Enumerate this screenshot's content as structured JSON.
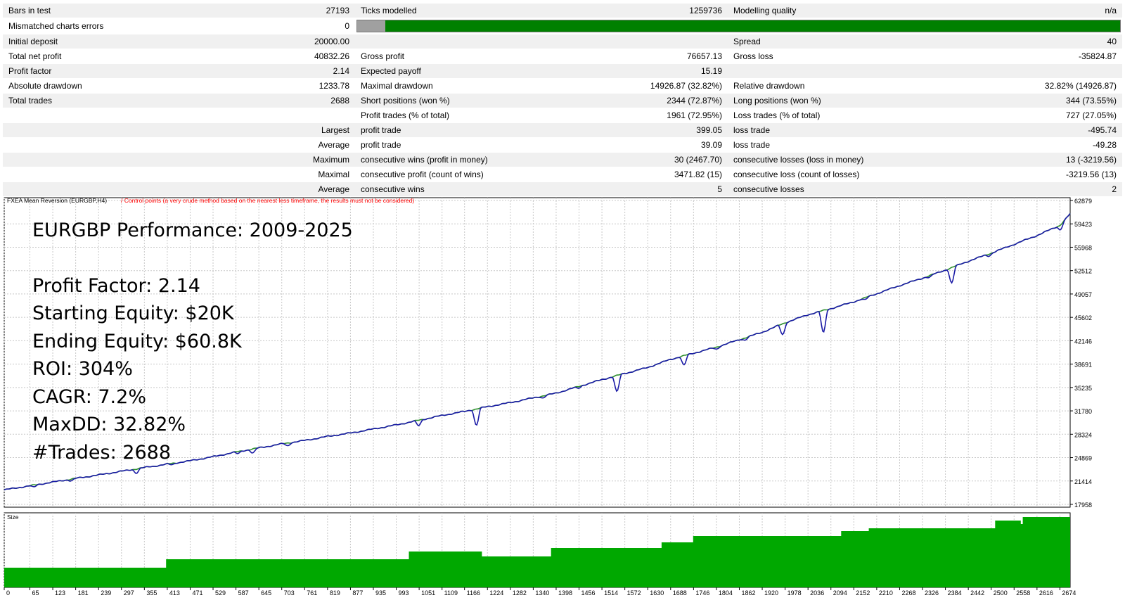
{
  "report": {
    "rows": [
      [
        "Bars in test",
        "27193",
        "Ticks modelled",
        "1259736",
        "Modelling quality",
        "n/a"
      ],
      [
        "Mismatched charts errors",
        "0",
        "__BAR__",
        "",
        "",
        ""
      ],
      [
        "Initial deposit",
        "20000.00",
        "",
        "",
        "Spread",
        "40"
      ],
      [
        "Total net profit",
        "40832.26",
        "Gross profit",
        "76657.13",
        "Gross loss",
        "-35824.87"
      ],
      [
        "Profit factor",
        "2.14",
        "Expected payoff",
        "15.19",
        "",
        ""
      ],
      [
        "Absolute drawdown",
        "1233.78",
        "Maximal drawdown",
        "14926.87 (32.82%)",
        "Relative drawdown",
        "32.82% (14926.87)"
      ],
      [
        "Total trades",
        "2688",
        "Short positions (won %)",
        "2344 (72.87%)",
        "Long positions (won %)",
        "344 (73.55%)"
      ],
      [
        "",
        "",
        "Profit trades (% of total)",
        "1961 (72.95%)",
        "Loss trades (% of total)",
        "727 (27.05%)"
      ],
      [
        "",
        "Largest",
        "profit trade",
        "399.05",
        "loss trade",
        "-495.74"
      ],
      [
        "",
        "Average",
        "profit trade",
        "39.09",
        "loss trade",
        "-49.28"
      ],
      [
        "",
        "Maximum",
        "consecutive wins (profit in money)",
        "30 (2467.70)",
        "consecutive losses (loss in money)",
        "13 (-3219.56)"
      ],
      [
        "",
        "Maximal",
        "consecutive profit (count of wins)",
        "3471.82 (15)",
        "consecutive loss (count of losses)",
        "-3219.56 (13)"
      ],
      [
        "",
        "Average",
        "consecutive wins",
        "5",
        "consecutive losses",
        "2"
      ]
    ],
    "quality_fraction": 0.037,
    "colors": {
      "bar_green": "#008000",
      "bar_grey": "#a0a0a0"
    }
  },
  "chart_data": {
    "type": "line",
    "header_title": "FXEA Mean Reversion (EURGBP,H4)",
    "header_note": "/ Control points (a very crude method based on the nearest less timeframe, the results must not be considered)",
    "overlay_lines": [
      "EURGBP Performance: 2009-2025",
      "Profit Factor: 2.14",
      "Starting Equity: $20K",
      "Ending Equity: $60.8K",
      "ROI: 304%",
      "CAGR: 7.2%",
      "MaxDD: 32.82%",
      "#Trades: 2688"
    ],
    "y_ticks": [
      "62879",
      "59423",
      "55968",
      "52512",
      "49057",
      "45602",
      "42146",
      "38691",
      "35235",
      "31780",
      "28324",
      "24869",
      "21414",
      "17958"
    ],
    "ylim": [
      17958,
      62879
    ],
    "x_ticks": [
      "0",
      "65",
      "123",
      "181",
      "239",
      "297",
      "355",
      "413",
      "471",
      "529",
      "587",
      "645",
      "703",
      "761",
      "819",
      "877",
      "935",
      "993",
      "1051",
      "1109",
      "1166",
      "1224",
      "1282",
      "1340",
      "1398",
      "1456",
      "1514",
      "1572",
      "1630",
      "1688",
      "1746",
      "1804",
      "1862",
      "1920",
      "1978",
      "2036",
      "2094",
      "2152",
      "2210",
      "2268",
      "2326",
      "2384",
      "2442",
      "2500",
      "2558",
      "2616",
      "2674"
    ],
    "xlim": [
      0,
      2700
    ],
    "balance_x": [
      0,
      65,
      123,
      181,
      239,
      297,
      355,
      413,
      471,
      529,
      587,
      645,
      703,
      761,
      819,
      877,
      935,
      993,
      1051,
      1109,
      1166,
      1224,
      1282,
      1340,
      1398,
      1456,
      1514,
      1572,
      1630,
      1688,
      1746,
      1804,
      1862,
      1920,
      1978,
      2036,
      2094,
      2152,
      2210,
      2268,
      2326,
      2384,
      2442,
      2500,
      2558,
      2616,
      2674,
      2700
    ],
    "balance_y": [
      20100,
      20700,
      21250,
      21800,
      22300,
      22850,
      23400,
      23900,
      24400,
      25000,
      25700,
      26300,
      26900,
      27400,
      28000,
      28500,
      29100,
      29700,
      30400,
      31100,
      31700,
      32400,
      33000,
      33700,
      34400,
      35400,
      36400,
      37300,
      38200,
      39400,
      40300,
      41200,
      42300,
      43400,
      44800,
      46000,
      46900,
      47900,
      49100,
      50300,
      51400,
      52600,
      53900,
      55100,
      56400,
      57700,
      59200,
      60900
    ],
    "drawdowns": [
      {
        "x": 75,
        "depth": 300
      },
      {
        "x": 170,
        "depth": 250
      },
      {
        "x": 335,
        "depth": 600
      },
      {
        "x": 425,
        "depth": 200
      },
      {
        "x": 592,
        "depth": 300
      },
      {
        "x": 630,
        "depth": 600
      },
      {
        "x": 718,
        "depth": 400
      },
      {
        "x": 1050,
        "depth": 800
      },
      {
        "x": 1196,
        "depth": 2400
      },
      {
        "x": 1365,
        "depth": 300
      },
      {
        "x": 1455,
        "depth": 250
      },
      {
        "x": 1552,
        "depth": 2400
      },
      {
        "x": 1722,
        "depth": 1400
      },
      {
        "x": 1805,
        "depth": 300
      },
      {
        "x": 1877,
        "depth": 300
      },
      {
        "x": 1972,
        "depth": 1600
      },
      {
        "x": 2075,
        "depth": 3300
      },
      {
        "x": 2181,
        "depth": 300
      },
      {
        "x": 2344,
        "depth": 250
      },
      {
        "x": 2400,
        "depth": 2300
      },
      {
        "x": 2495,
        "depth": 300
      },
      {
        "x": 2676,
        "depth": 700
      }
    ],
    "size_label": "Size",
    "size_x": [
      0,
      400,
      410,
      420,
      1005,
      1025,
      1200,
      1210,
      1385,
      1435,
      1665,
      1730,
      1745,
      2100,
      2120,
      2180,
      2190,
      2500,
      2510,
      2565,
      2575,
      2580,
      2700
    ],
    "size_y": [
      0.28,
      0.28,
      0.4,
      0.4,
      0.4,
      0.51,
      0.51,
      0.44,
      0.56,
      0.56,
      0.64,
      0.64,
      0.73,
      0.73,
      0.8,
      0.8,
      0.84,
      0.84,
      0.95,
      0.95,
      0.9,
      1.0,
      1.0
    ],
    "colors": {
      "balance": "#1a1aa6",
      "equity_dip": "#2d8f2d",
      "size_fill": "#00a800",
      "grid": "#c8c8c8",
      "header_red": "#ff0000"
    }
  }
}
